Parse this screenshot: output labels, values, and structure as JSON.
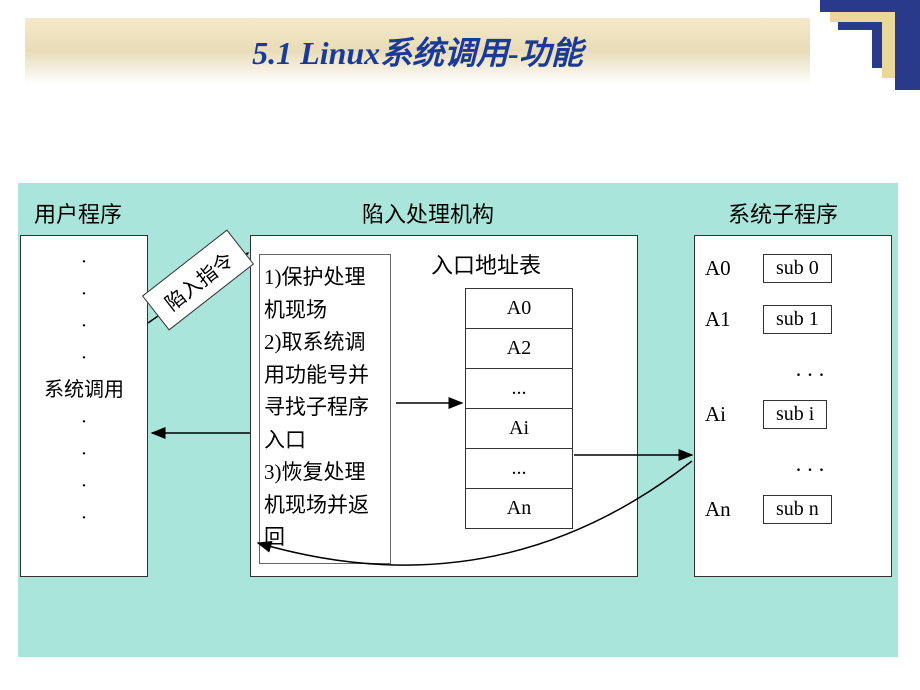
{
  "title": "5.1 Linux系统调用-功能",
  "sections": {
    "user": "用户程序",
    "trap": "陷入处理机构",
    "sys": "系统子程序"
  },
  "user_box_lines": "·\n·\n·\n·\n系统调用\n·\n·\n·\n·",
  "trap_cmd": "陷入指令",
  "trap_steps": "1)保护处理机现场\n2)取系统调用功能号并寻找子程序入口\n3)恢复处理机现场并返回",
  "entry_label": "入口地址表",
  "entries": {
    "e0": "A0",
    "e1": "A2",
    "e2": "...",
    "e3": "Ai",
    "e4": "...",
    "e5": "An"
  },
  "subs": {
    "r0a": "A0",
    "r0b": "sub 0",
    "r1a": "A1",
    "r1b": "sub 1",
    "r2a": "Ai",
    "r2b": "sub i",
    "r3a": "An",
    "r3b": "sub n",
    "dots": "..."
  }
}
